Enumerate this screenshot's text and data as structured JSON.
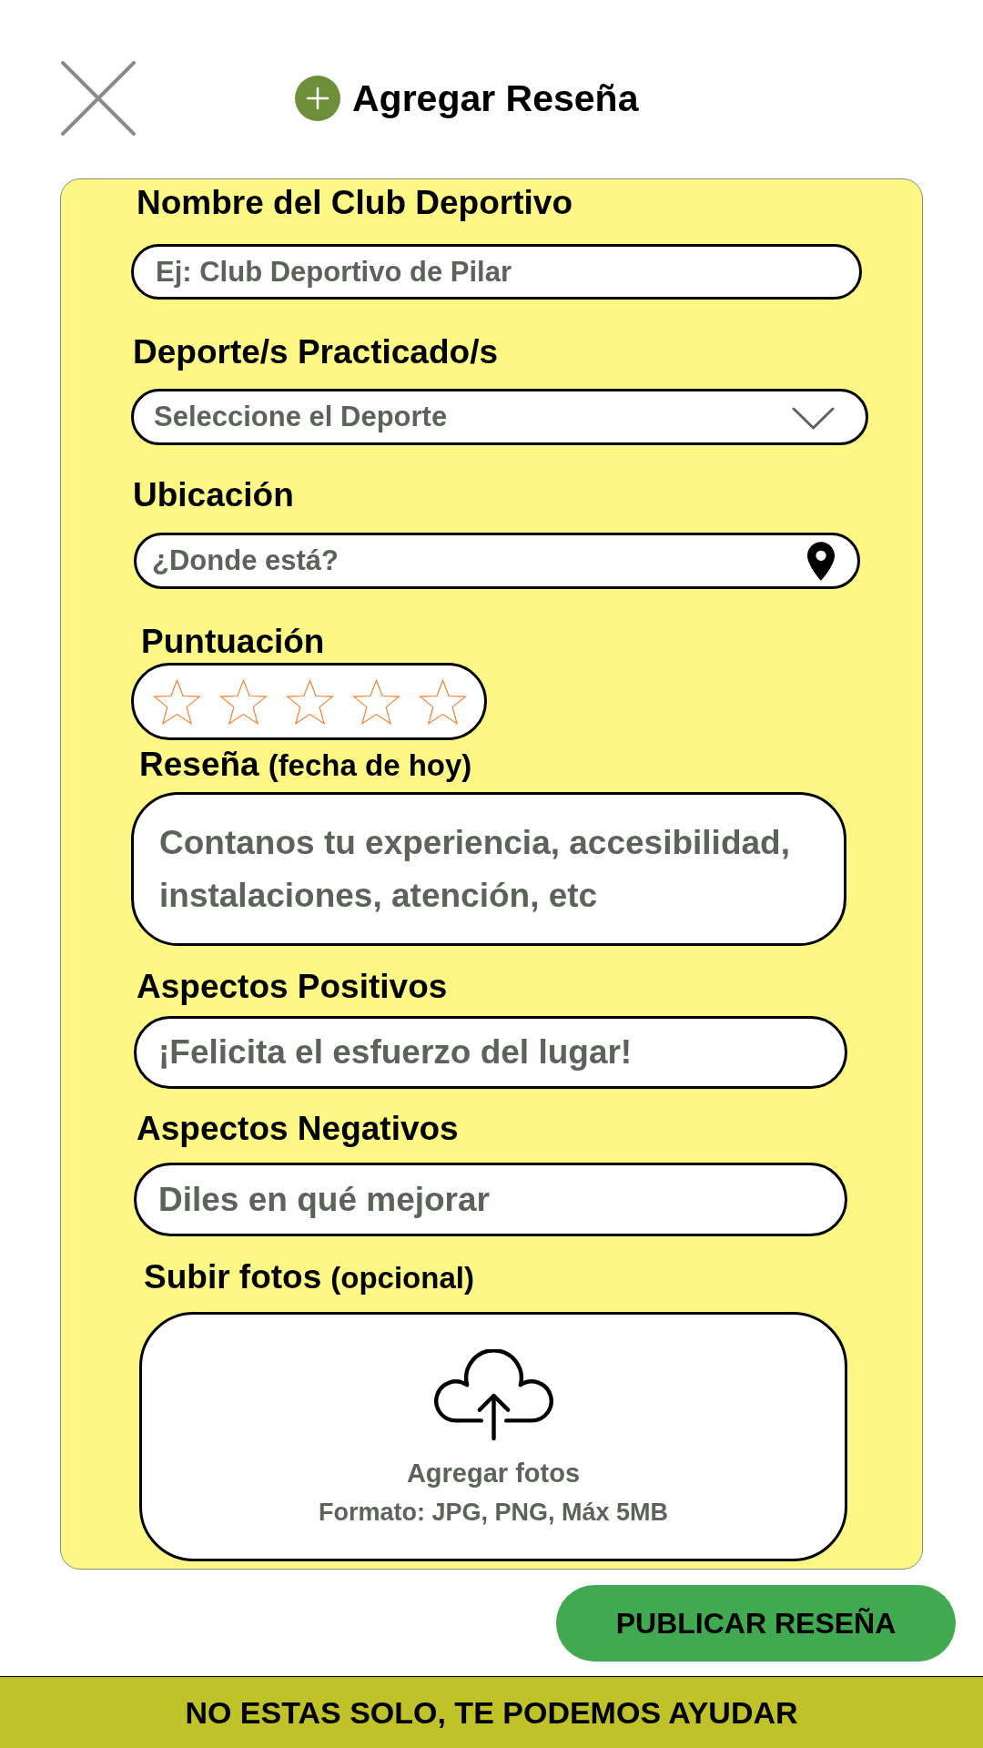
{
  "header": {
    "title": "Agregar Reseña"
  },
  "form": {
    "fields": [
      {
        "kind": "text",
        "label": "Nombre del Club Deportivo",
        "placeholder": "Ej: Club Deportivo de Pilar"
      },
      {
        "kind": "select",
        "label": "Deporte/s Practicado/s",
        "placeholder": "Seleccione el Deporte"
      },
      {
        "kind": "location",
        "label": "Ubicación",
        "placeholder": "¿Donde está?"
      },
      {
        "kind": "rating",
        "label": "Puntuación",
        "stars": 0
      },
      {
        "kind": "textarea",
        "label": "Reseña",
        "note": "(fecha de hoy)",
        "placeholder": "Contanos tu experiencia, accesibilidad, instalaciones, atención, etc"
      },
      {
        "kind": "text",
        "label": "Aspectos Positivos",
        "placeholder": "¡Felicita el esfuerzo del lugar!"
      },
      {
        "kind": "text",
        "label": "Aspectos Negativos",
        "placeholder": "Diles en qué mejorar"
      },
      {
        "kind": "upload",
        "label": "Subir fotos",
        "note": "(opcional)",
        "title": "Agregar fotos",
        "hint": "Formato: JPG, PNG, Máx 5MB"
      }
    ]
  },
  "submit_button": {
    "label": "PUBLICAR RESEÑA"
  },
  "help_banner": {
    "text": "NO ESTAS SOLO, TE PODEMOS AYUDAR"
  }
}
